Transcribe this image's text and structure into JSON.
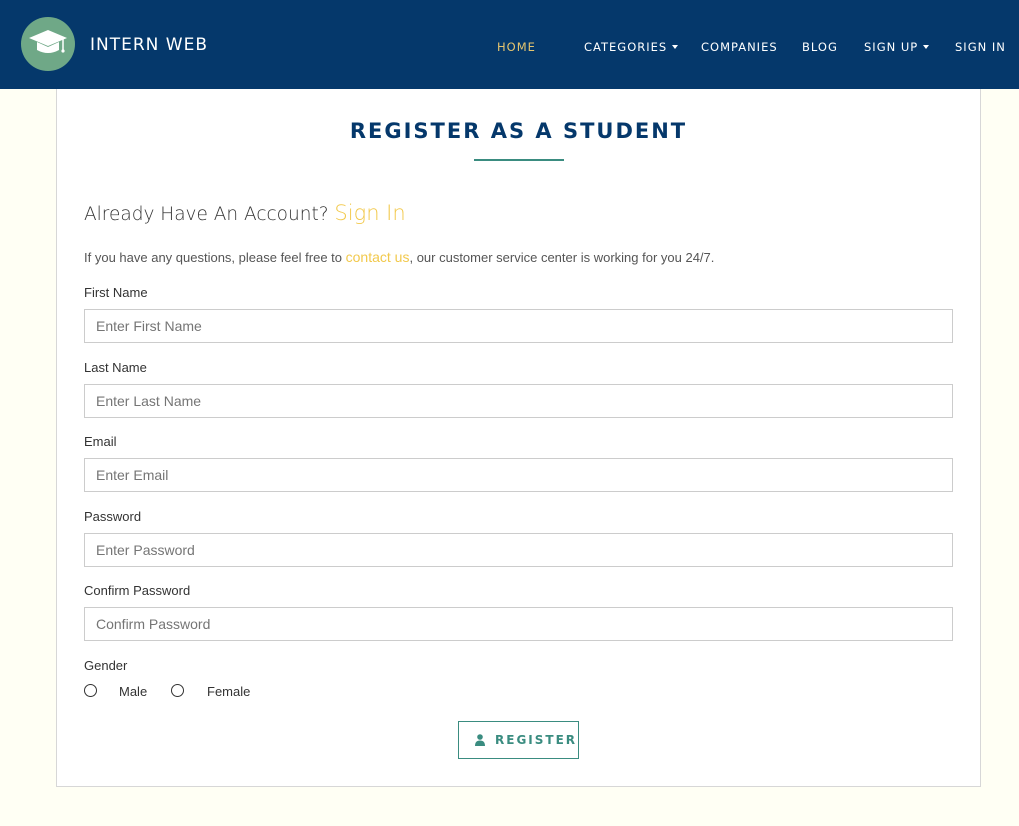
{
  "nav": {
    "brand": "INTERN WEB",
    "items": [
      {
        "label": "HOME"
      },
      {
        "label": "CATEGORIES"
      },
      {
        "label": "COMPANIES"
      },
      {
        "label": "BLOG"
      },
      {
        "label": "SIGN UP"
      },
      {
        "label": "SIGN IN"
      }
    ]
  },
  "form": {
    "title": "REGISTER AS A STUDENT",
    "account_prompt": "Already Have An Account?",
    "account_link": "Sign In",
    "info_before": "If you have any questions, please feel free to",
    "info_link": "contact us",
    "info_after": ", our customer service center is working for you 24/7.",
    "fields": [
      {
        "label": "First Name",
        "placeholder": "Enter First Name"
      },
      {
        "label": "Last Name",
        "placeholder": "Enter Last Name"
      },
      {
        "label": "Email",
        "placeholder": "Enter Email"
      },
      {
        "label": "Password",
        "placeholder": "Enter Password"
      },
      {
        "label": "Confirm Password",
        "placeholder": "Confirm Password"
      }
    ],
    "gender_label": "Gender",
    "gender_options": [
      "Male",
      "Female"
    ],
    "submit_label": "REGISTER"
  },
  "colors": {
    "navbar": "#05386b",
    "accent_gold": "#f2c94c",
    "accent_teal": "#3a8c80",
    "page_bg": "#fffff4"
  },
  "icons": {
    "logo": "graduation-cap-icon",
    "submit": "user-icon"
  }
}
